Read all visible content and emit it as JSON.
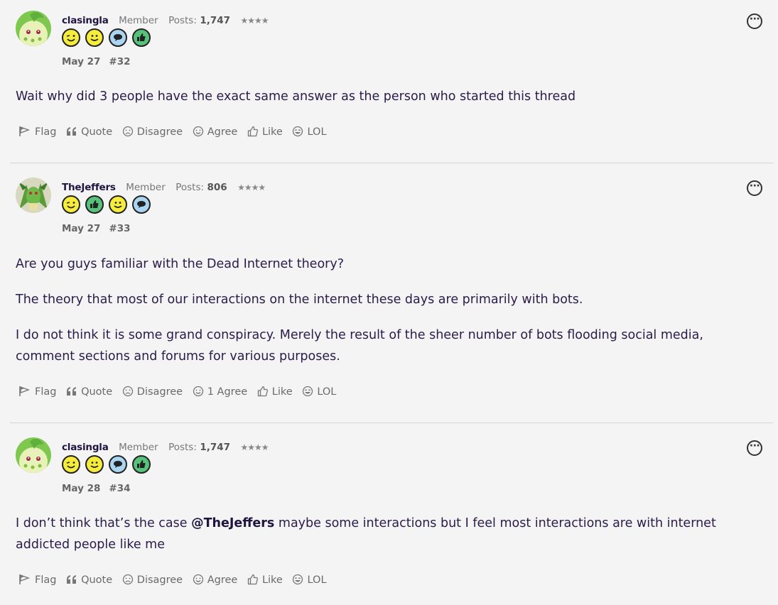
{
  "posts": [
    {
      "username": "clasingla",
      "role": "Member",
      "posts_label": "Posts:",
      "posts_count": "1,747",
      "stars": "★★★★",
      "date": "May 27",
      "number": "#32",
      "avatar_icon": "chikorita-avatar-icon",
      "badges": [
        "wink-badge-icon",
        "smile-badge-icon",
        "speech-badge-icon",
        "thumbs-up-badge-icon"
      ],
      "paragraphs": [
        "Wait why did 3 people have the exact same answer as the person who started this thread"
      ],
      "actions": {
        "flag": "Flag",
        "quote": "Quote",
        "disagree": "Disagree",
        "agree": "Agree",
        "like": "Like",
        "lol": "LOL"
      }
    },
    {
      "username": "TheJeffers",
      "role": "Member",
      "posts_label": "Posts:",
      "posts_count": "806",
      "stars": "★★★★",
      "date": "May 27",
      "number": "#33",
      "avatar_icon": "scyther-avatar-icon",
      "badges": [
        "wink-badge-icon",
        "thumbs-up-badge-icon",
        "smile-badge-icon",
        "speech-badge-icon"
      ],
      "paragraphs": [
        "Are you guys familiar with the Dead Internet theory?",
        "The theory that most of our interactions on the internet these days are primarily with bots.",
        "I do not think it is some grand conspiracy. Merely the result of the sheer number of bots flooding social media, comment sections and forums for various purposes."
      ],
      "actions": {
        "flag": "Flag",
        "quote": "Quote",
        "disagree": "Disagree",
        "agree": "1 Agree",
        "like": "Like",
        "lol": "LOL"
      }
    },
    {
      "username": "clasingla",
      "role": "Member",
      "posts_label": "Posts:",
      "posts_count": "1,747",
      "stars": "★★★★",
      "date": "May 28",
      "number": "#34",
      "avatar_icon": "chikorita-avatar-icon",
      "badges": [
        "wink-badge-icon",
        "smile-badge-icon",
        "speech-badge-icon",
        "thumbs-up-badge-icon"
      ],
      "paragraphs_pre": "I don’t think that’s the case ",
      "mention": "@TheJeffers",
      "paragraphs_post": " maybe some interactions but I feel most interactions are with internet addicted people like me",
      "actions": {
        "flag": "Flag",
        "quote": "Quote",
        "disagree": "Disagree",
        "agree": "Agree",
        "like": "Like",
        "lol": "LOL"
      }
    }
  ],
  "more_menu_label": "···",
  "colors": {
    "text": "#2a1c4a",
    "muted": "#6a6a6a",
    "background": "#f4f4f4",
    "badge_yellow": "#f5ec3c",
    "badge_blue": "#a9d4f2",
    "badge_green": "#57c27a"
  }
}
